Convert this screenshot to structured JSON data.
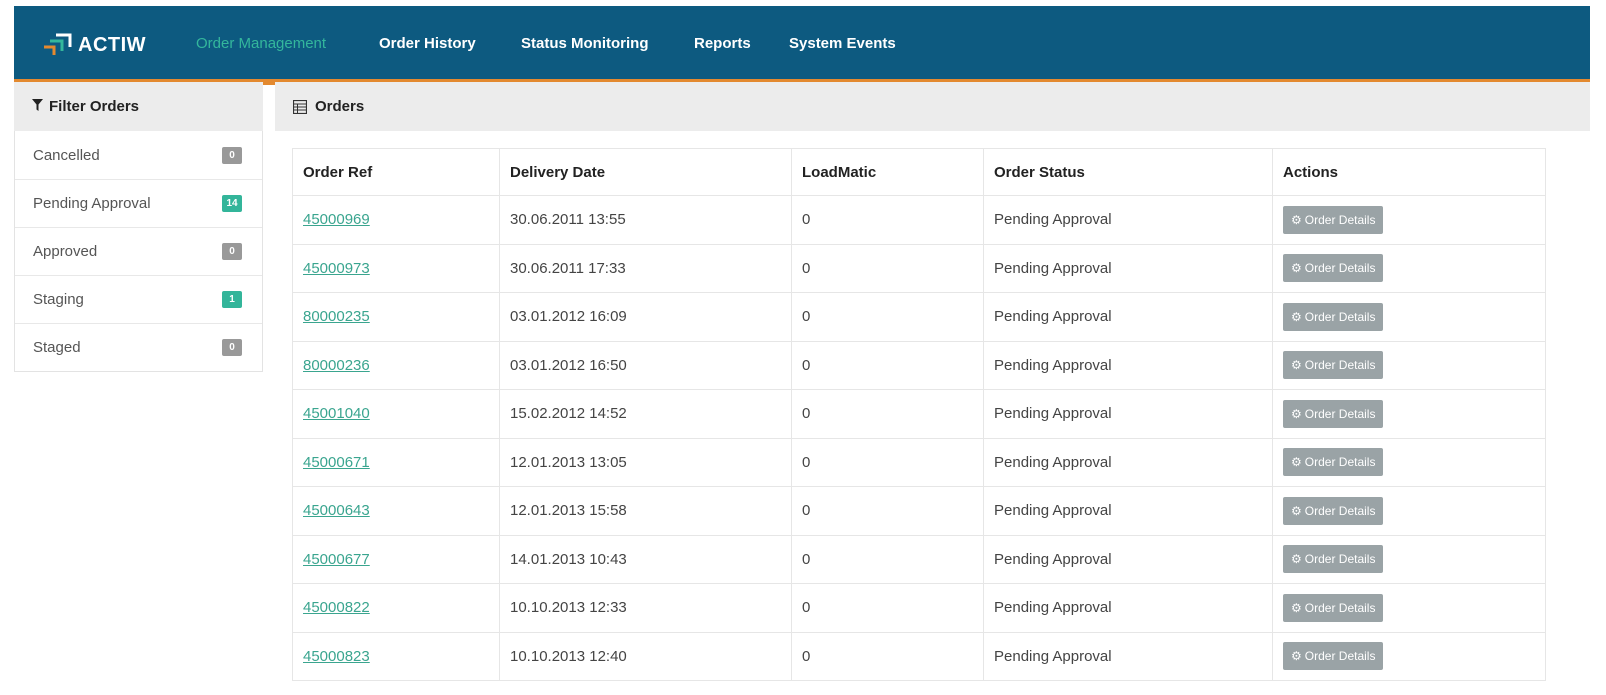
{
  "brand": {
    "name": "ACTIW"
  },
  "nav": {
    "items": [
      {
        "label": "Order Management",
        "active": true
      },
      {
        "label": "Order History",
        "active": false
      },
      {
        "label": "Status Monitoring",
        "active": false
      },
      {
        "label": "Reports",
        "active": false
      },
      {
        "label": "System Events",
        "active": false
      }
    ]
  },
  "sidebar": {
    "title": "Filter Orders",
    "items": [
      {
        "label": "Cancelled",
        "count": "0",
        "badge_color": "#999999"
      },
      {
        "label": "Pending Approval",
        "count": "14",
        "badge_color": "#33b59a"
      },
      {
        "label": "Approved",
        "count": "0",
        "badge_color": "#999999"
      },
      {
        "label": "Staging",
        "count": "1",
        "badge_color": "#33b59a"
      },
      {
        "label": "Staged",
        "count": "0",
        "badge_color": "#999999"
      }
    ]
  },
  "orders": {
    "title": "Orders",
    "columns": [
      "Order Ref",
      "Delivery Date",
      "LoadMatic",
      "Order Status",
      "Actions"
    ],
    "action_label": "Order Details",
    "rows": [
      {
        "ref": "45000969",
        "date": "30.06.2011 13:55",
        "loadmatic": "0",
        "status": "Pending Approval"
      },
      {
        "ref": "45000973",
        "date": "30.06.2011 17:33",
        "loadmatic": "0",
        "status": "Pending Approval"
      },
      {
        "ref": "80000235",
        "date": "03.01.2012 16:09",
        "loadmatic": "0",
        "status": "Pending Approval"
      },
      {
        "ref": "80000236",
        "date": "03.01.2012 16:50",
        "loadmatic": "0",
        "status": "Pending Approval"
      },
      {
        "ref": "45001040",
        "date": "15.02.2012 14:52",
        "loadmatic": "0",
        "status": "Pending Approval"
      },
      {
        "ref": "45000671",
        "date": "12.01.2013 13:05",
        "loadmatic": "0",
        "status": "Pending Approval"
      },
      {
        "ref": "45000643",
        "date": "12.01.2013 15:58",
        "loadmatic": "0",
        "status": "Pending Approval"
      },
      {
        "ref": "45000677",
        "date": "14.01.2013 10:43",
        "loadmatic": "0",
        "status": "Pending Approval"
      },
      {
        "ref": "45000822",
        "date": "10.10.2013 12:33",
        "loadmatic": "0",
        "status": "Pending Approval"
      },
      {
        "ref": "45000823",
        "date": "10.10.2013 12:40",
        "loadmatic": "0",
        "status": "Pending Approval"
      }
    ]
  },
  "colors": {
    "navbar": "#0d5a80",
    "accent_orange": "#e3892f",
    "accent_green": "#34b79c",
    "button_gray": "#9aa3a6"
  },
  "icons": {
    "filter": "filter-icon",
    "table": "table-icon",
    "gear": "gear-icon",
    "logo": "actiw-logo-icon"
  }
}
